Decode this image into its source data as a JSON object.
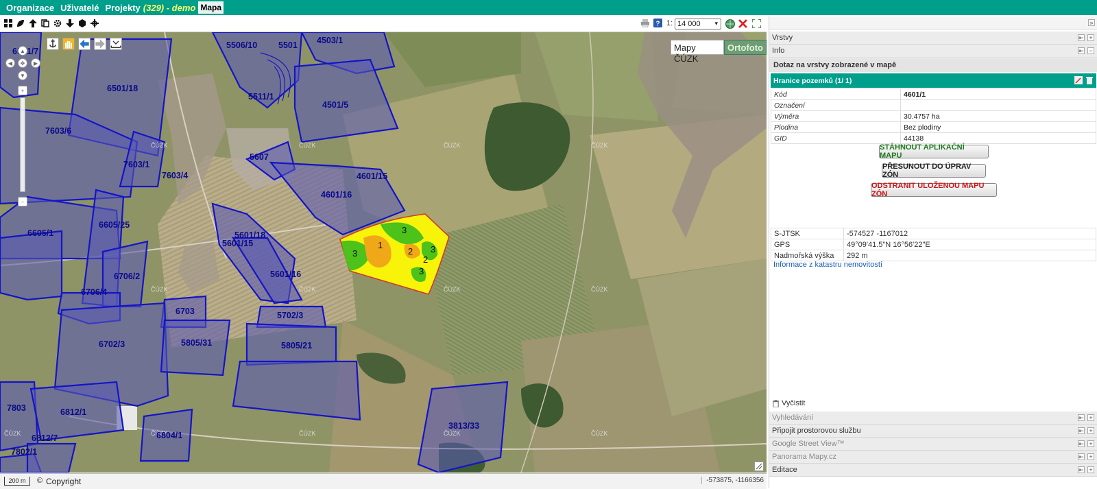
{
  "topbar": {
    "nav": [
      "Organizace",
      "Uživatelé",
      "Projekty"
    ],
    "project_count": "(329) - demo",
    "active_tab": "Mapa"
  },
  "toolbar": {
    "scale_prefix": "1:",
    "scale_value": "14 000",
    "icons": [
      "grid-icon",
      "leaf-icon",
      "arrow-up-icon",
      "copy-icon",
      "gear-icon",
      "arrow-down-icon",
      "hexagon-icon",
      "crosshair-icon",
      "print-icon",
      "help-icon",
      "globe-icon",
      "close-icon",
      "fullscreen-icon"
    ]
  },
  "map": {
    "type_buttons": [
      "Mapy ČÚZK",
      "Ortofoto"
    ],
    "active_type": "Ortofoto",
    "watermark": "ČÚZK",
    "parcels": [
      "6501/7",
      "5506/10",
      "5501",
      "4503/1",
      "6501/18",
      "5511/1",
      "4501/5",
      "7603/6",
      "7603/1",
      "7603/4",
      "5607",
      "4601/15",
      "4601/16",
      "6605/25",
      "6605/1",
      "5601/18",
      "5601/15",
      "6706/2",
      "5601/16",
      "6706/4",
      "6703",
      "5702/3",
      "6702/3",
      "5805/31",
      "5805/21",
      "7803",
      "6812/1",
      "3813/33",
      "6804/1",
      "6812/7",
      "7802/1"
    ],
    "zone_labels": [
      "1",
      "2",
      "3"
    ],
    "scale_bar": "200 m",
    "copyright": "Copyright",
    "cursor_coords": "-573875, -1166356"
  },
  "panel": {
    "sections_top": [
      "Vrstvy",
      "Info"
    ],
    "query_title": "Dotaz na vrstvy zobrazené v mapě",
    "layer_title": "Hranice pozemků (1/ 1)",
    "attributes": [
      {
        "key": "Kód",
        "value": "4601/1"
      },
      {
        "key": "Označení",
        "value": ""
      },
      {
        "key": "Výměra",
        "value": "30.4757 ha"
      },
      {
        "key": "Plodina",
        "value": "Bez plodiny"
      },
      {
        "key": "GID",
        "value": "44138"
      }
    ],
    "buttons": {
      "download": "STÁHNOUT APLIKAČNÍ MAPU",
      "move": "PŘESUNOUT DO ÚPRAV ZÓN",
      "remove": "ODSTRANIT ULOŽENOU MAPU ZÓN"
    },
    "coords": [
      {
        "key": "S-JTSK",
        "value": "-574527 -1167012"
      },
      {
        "key": "GPS",
        "value": "49°09'41.5\"N 16°56'22\"E"
      },
      {
        "key": "Nadmořská výška",
        "value": "292 m"
      }
    ],
    "katastr_link": "Informace z katastru nemovitostí",
    "clear": "Vyčistit",
    "sections_bottom": [
      "Vyhledávání",
      "Připojit prostorovou službu",
      "Google Street View™",
      "Panorama Mapy.cz",
      "Editace"
    ],
    "colors": {
      "accent": "#009f8b",
      "download": "#1e7a1e",
      "remove": "#cc1111",
      "link": "#1a5fb4"
    }
  }
}
